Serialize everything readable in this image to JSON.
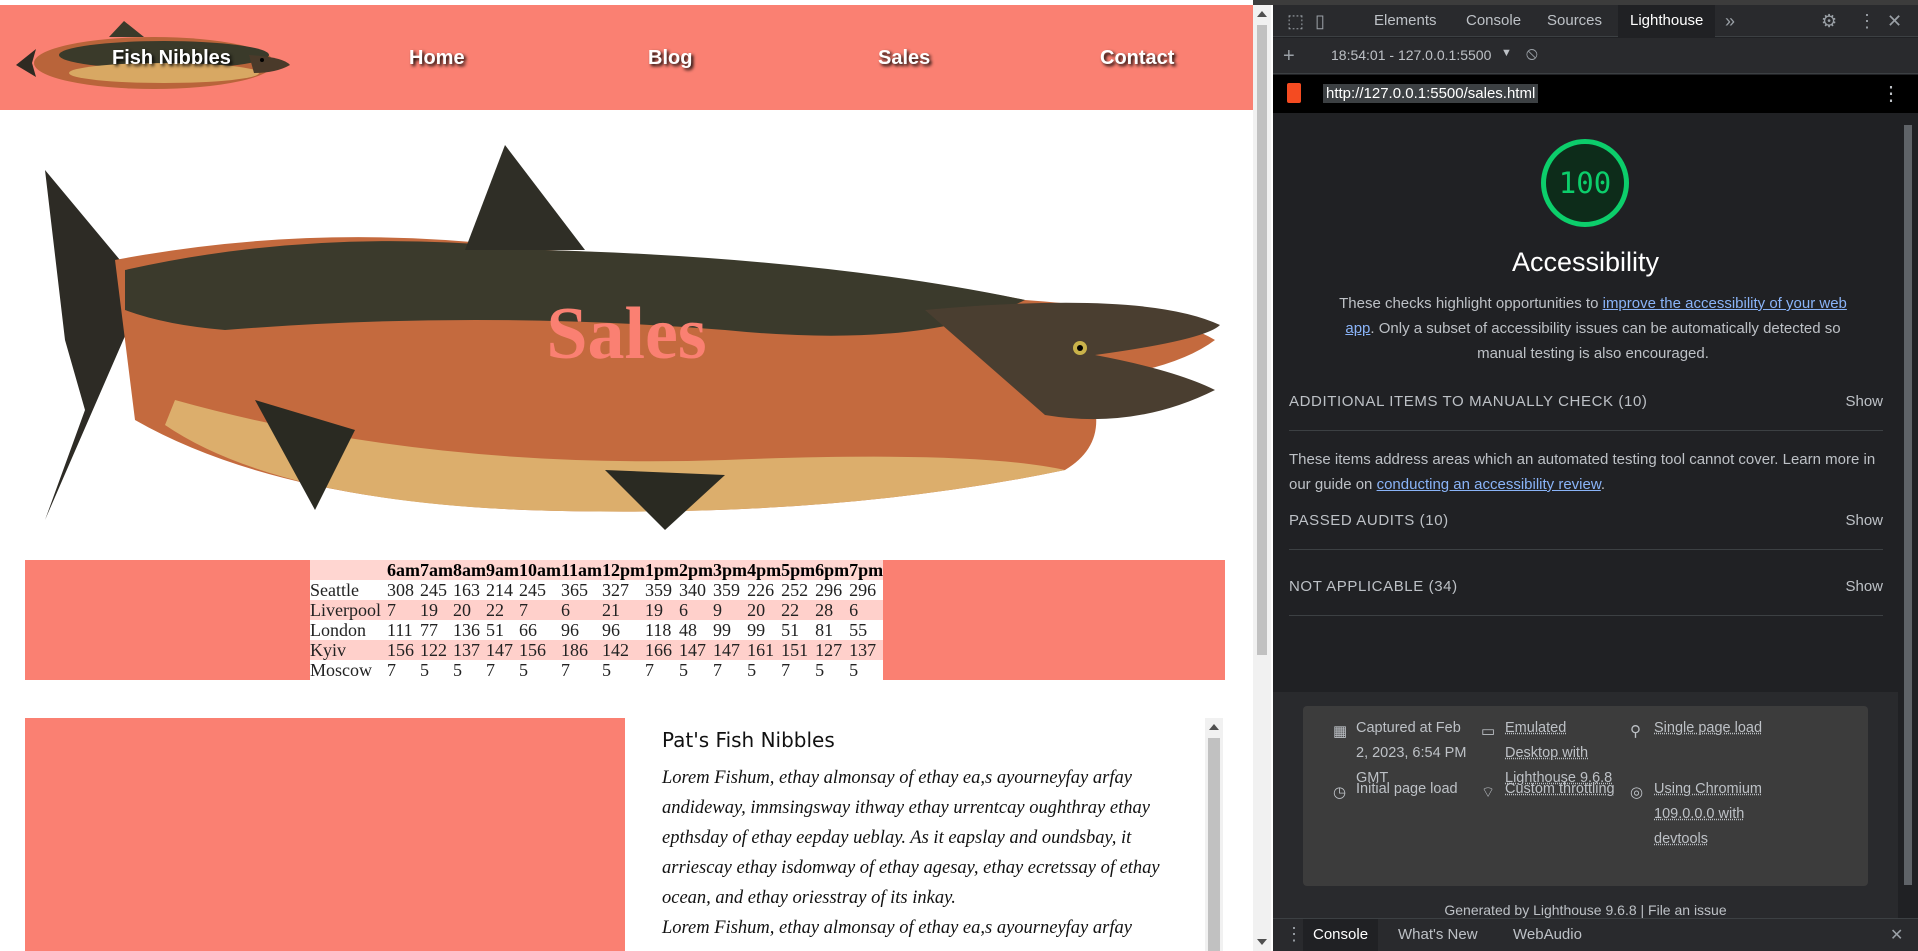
{
  "nav": {
    "brand": "Fish Nibbles",
    "links": [
      "Home",
      "Blog",
      "Sales",
      "Contact"
    ]
  },
  "hero": {
    "title": "Sales"
  },
  "sales_table": {
    "headers": [
      "",
      "6am",
      "7am",
      "8am",
      "9am",
      "10am",
      "11am",
      "12pm",
      "1pm",
      "2pm",
      "3pm",
      "4pm",
      "5pm",
      "6pm",
      "7pm"
    ],
    "rows": [
      [
        "Seattle",
        "308",
        "245",
        "163",
        "214",
        "245",
        "365",
        "327",
        "359",
        "340",
        "359",
        "226",
        "252",
        "296",
        "296"
      ],
      [
        "Liverpool",
        "7",
        "19",
        "20",
        "22",
        "7",
        "6",
        "21",
        "19",
        "6",
        "9",
        "20",
        "22",
        "28",
        "6"
      ],
      [
        "London",
        "111",
        "77",
        "136",
        "51",
        "66",
        "96",
        "96",
        "118",
        "48",
        "99",
        "99",
        "51",
        "81",
        "55"
      ],
      [
        "Kyiv",
        "156",
        "122",
        "137",
        "147",
        "156",
        "186",
        "142",
        "166",
        "147",
        "147",
        "161",
        "151",
        "127",
        "137"
      ],
      [
        "Moscow",
        "7",
        "5",
        "5",
        "7",
        "5",
        "7",
        "5",
        "7",
        "5",
        "7",
        "5",
        "7",
        "5",
        "5"
      ]
    ]
  },
  "article": {
    "heading": "Pat's Fish Nibbles",
    "paragraph1": "Lorem Fishum, ethay almonsay of ethay ea,s ayourneyfay arfay andideway, immsingsway ithway ethay urrentcay oughthray ethay epthsday of ethay eepday ueblay. As it eapslay and oundsbay, it arriescay ethay isdomway of ethay agesay, ethay ecretssay of ethay ocean, and ethay oriesstray of its inkay.",
    "paragraph2": "Lorem Fishum, ethay almonsay of ethay ea,s ayourneyfay arfay"
  },
  "devtools": {
    "tabs": [
      "Elements",
      "Console",
      "Sources",
      "Lighthouse"
    ],
    "active_tab": "Lighthouse",
    "more_tabs": "»",
    "report_selector": "18:54:01 - 127.0.0.1:5500",
    "url": "http://127.0.0.1:5500/sales.html",
    "lighthouse": {
      "score": "100",
      "category": "Accessibility",
      "desc_before": "These checks highlight opportunities to ",
      "desc_link": "improve the accessibility of your web app",
      "desc_after": ". Only a subset of accessibility issues can be automatically detected so manual testing is also encouraged.",
      "sections": [
        {
          "title": "ADDITIONAL ITEMS TO MANUALLY CHECK (10)",
          "action": "Show"
        },
        {
          "title": "PASSED AUDITS (10)",
          "action": "Show"
        },
        {
          "title": "NOT APPLICABLE (34)",
          "action": "Show"
        }
      ],
      "note_before": "These items address areas which an automated testing tool cannot cover. Learn more in our guide on ",
      "note_link": "conducting an accessibility review",
      "note_after": ".",
      "meta": {
        "captured": "Captured at Feb 2, 2023, 6:54 PM GMT",
        "emulated": "Emulated Desktop with Lighthouse 9.6.8",
        "single": "Single page load",
        "initial": "Initial page load",
        "throttling": "Custom throttling",
        "chromium": "Using Chromium 109.0.0.0 with devtools"
      },
      "generated": "Generated by Lighthouse 9.6.8 | File an issue"
    },
    "drawer": [
      "Console",
      "What's New",
      "WebAudio"
    ],
    "drawer_active": "Console"
  },
  "colors": {
    "salmon": "#fa8072",
    "score_green": "#0cce6b"
  }
}
